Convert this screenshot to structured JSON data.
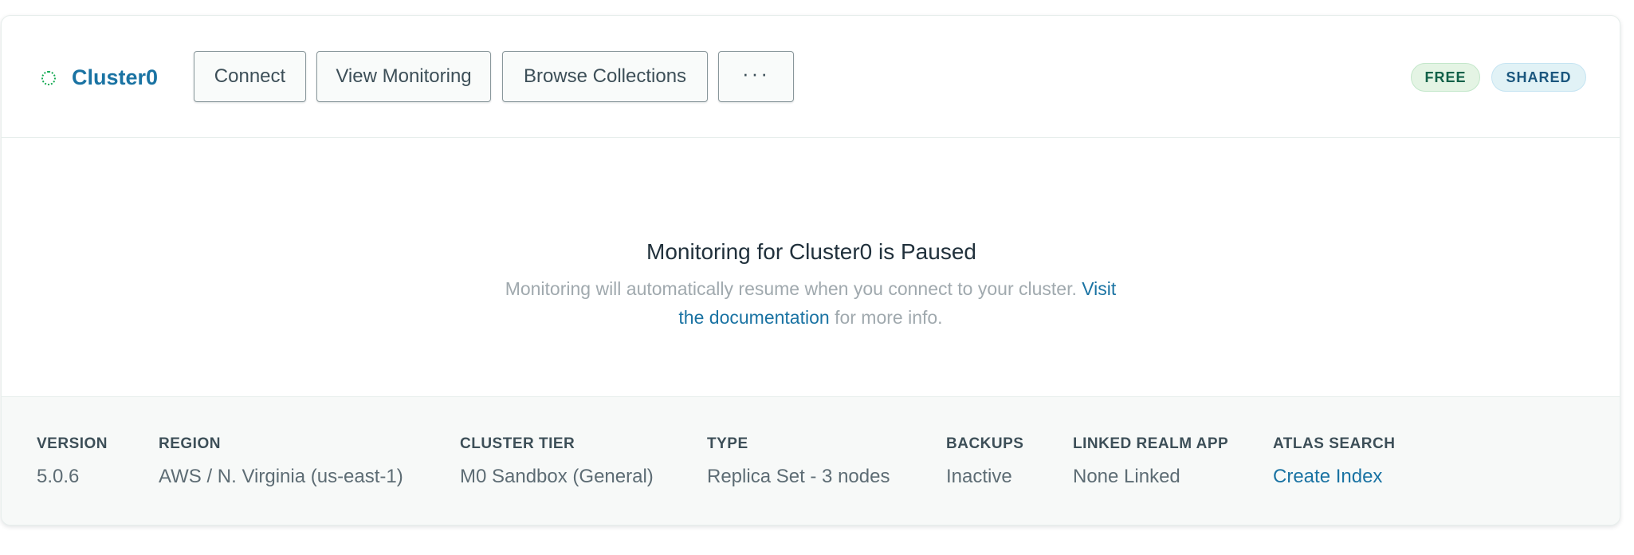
{
  "cluster": {
    "name": "Cluster0",
    "status_color": "#13aa52"
  },
  "actions": {
    "connect": "Connect",
    "view_monitoring": "View Monitoring",
    "browse_collections": "Browse Collections",
    "more": "···"
  },
  "badges": {
    "free": "FREE",
    "shared": "SHARED"
  },
  "monitoring": {
    "title": "Monitoring for Cluster0 is Paused",
    "message": "Monitoring will automatically resume when you connect to your cluster.",
    "link_text": "Visit the documentation",
    "suffix": "for more info."
  },
  "details": [
    {
      "label": "VERSION",
      "value": "5.0.6"
    },
    {
      "label": "REGION",
      "value": "AWS / N. Virginia (us-east-1)"
    },
    {
      "label": "CLUSTER TIER",
      "value": "M0 Sandbox (General)"
    },
    {
      "label": "TYPE",
      "value": "Replica Set - 3 nodes"
    },
    {
      "label": "BACKUPS",
      "value": "Inactive"
    },
    {
      "label": "LINKED REALM APP",
      "value": "None Linked"
    },
    {
      "label": "ATLAS SEARCH",
      "value": "Create Index"
    }
  ],
  "colors": {
    "link": "#1a73a3",
    "free_badge_bg": "#e4f4e4",
    "shared_badge_bg": "#e1f2f6"
  }
}
